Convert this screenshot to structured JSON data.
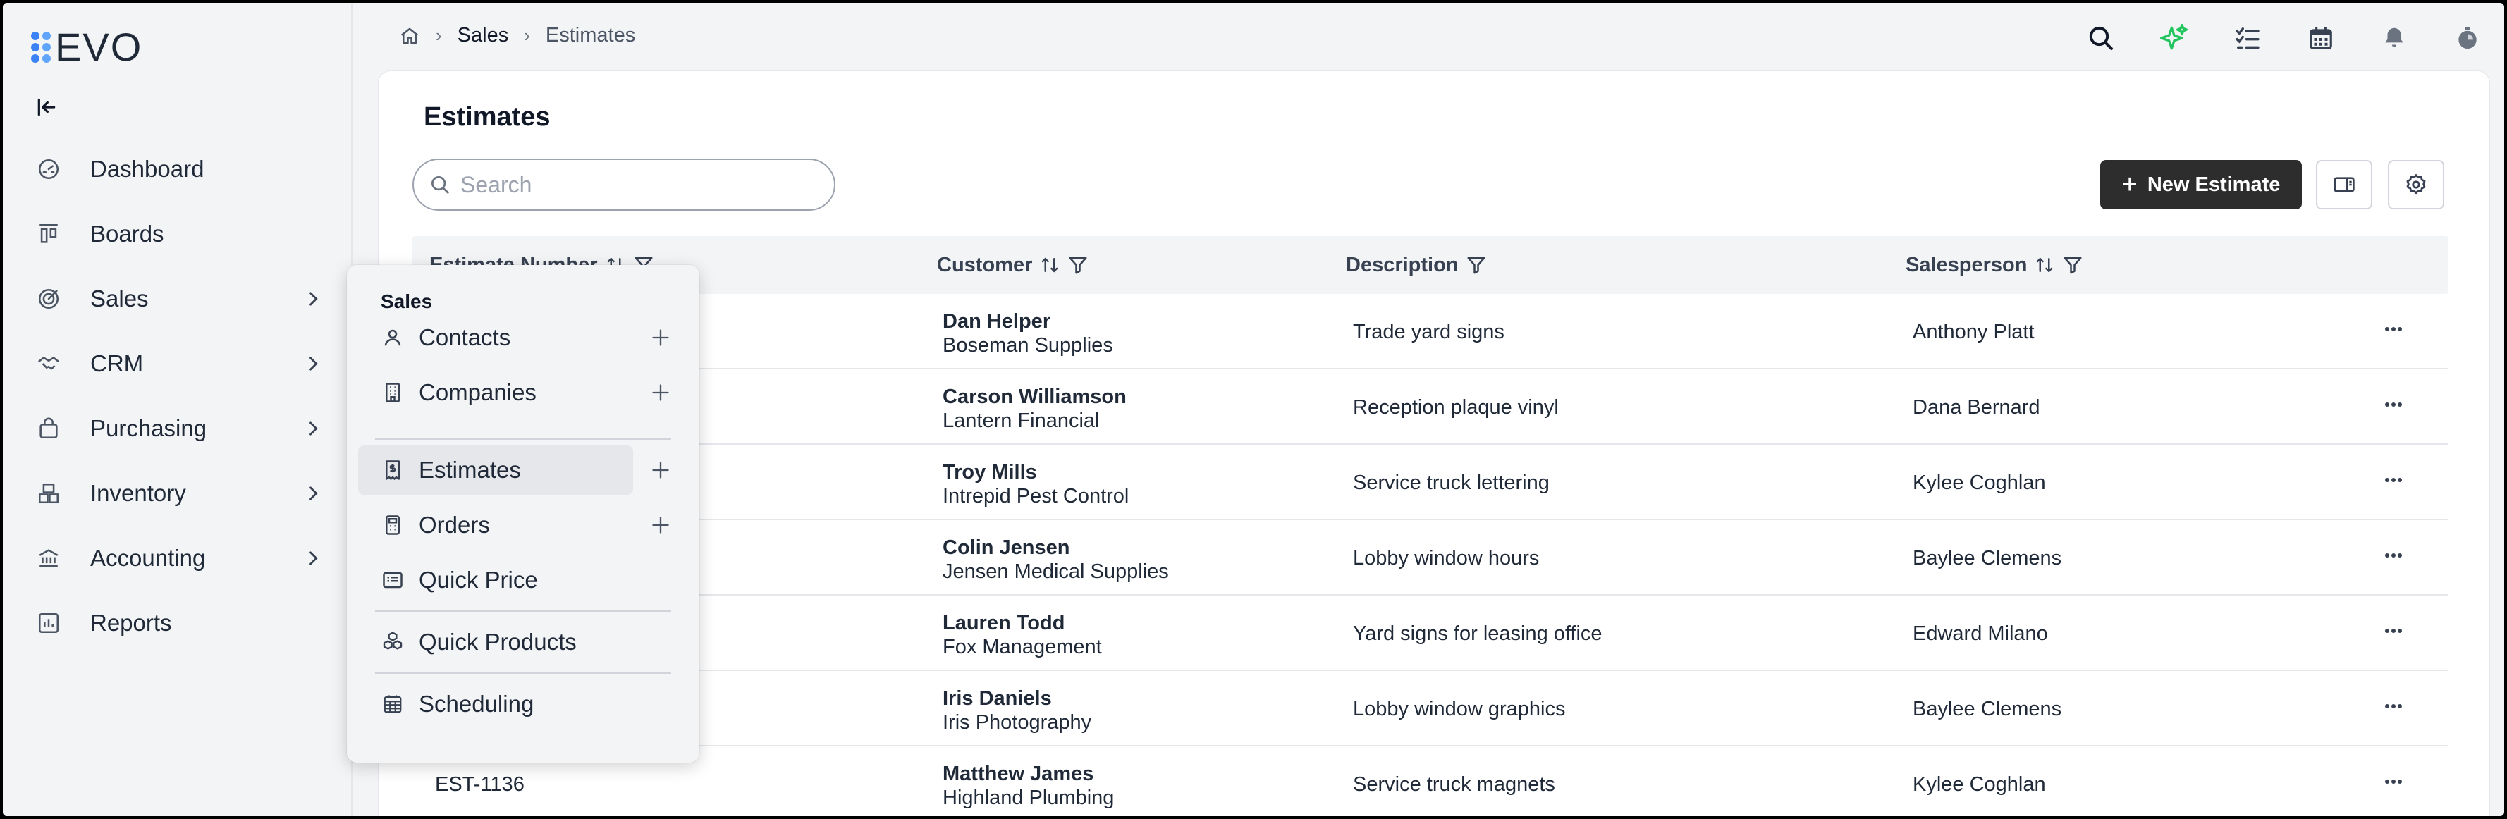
{
  "app": {
    "logo_text": "EVO"
  },
  "breadcrumb": {
    "items": [
      "Sales",
      "Estimates"
    ]
  },
  "sidebar": {
    "items": [
      {
        "label": "Dashboard",
        "icon": "dashboard-icon",
        "has_children": false
      },
      {
        "label": "Boards",
        "icon": "boards-icon",
        "has_children": false
      },
      {
        "label": "Sales",
        "icon": "sales-icon",
        "has_children": true
      },
      {
        "label": "CRM",
        "icon": "handshake-icon",
        "has_children": true
      },
      {
        "label": "Purchasing",
        "icon": "shopping-bag-icon",
        "has_children": true
      },
      {
        "label": "Inventory",
        "icon": "boxes-icon",
        "has_children": true
      },
      {
        "label": "Accounting",
        "icon": "bank-icon",
        "has_children": true
      },
      {
        "label": "Reports",
        "icon": "bar-chart-icon",
        "has_children": false
      }
    ]
  },
  "flyout": {
    "title": "Sales",
    "items": [
      {
        "label": "Contacts",
        "icon": "person-icon",
        "has_add": true
      },
      {
        "label": "Companies",
        "icon": "building-icon",
        "has_add": true
      },
      {
        "label": "Estimates",
        "icon": "estimate-icon",
        "has_add": true,
        "active": true
      },
      {
        "label": "Orders",
        "icon": "calculator-icon",
        "has_add": true
      },
      {
        "label": "Quick Price",
        "icon": "price-list-icon",
        "has_add": false
      },
      {
        "label": "Quick Products",
        "icon": "cubes-icon",
        "has_add": false
      },
      {
        "label": "Scheduling",
        "icon": "calendar-grid-icon",
        "has_add": false
      }
    ]
  },
  "page": {
    "title": "Estimates",
    "search_placeholder": "Search",
    "new_button_label": "New Estimate"
  },
  "table": {
    "columns": [
      "Estimate Number",
      "Customer",
      "Description",
      "Salesperson"
    ],
    "rows": [
      {
        "number": "",
        "contact": "Dan Helper",
        "company": "Boseman Supplies",
        "description": "Trade yard signs",
        "salesperson": "Anthony Platt"
      },
      {
        "number": "",
        "contact": "Carson Williamson",
        "company": "Lantern Financial",
        "description": "Reception plaque vinyl",
        "salesperson": "Dana Bernard"
      },
      {
        "number": "",
        "contact": "Troy Mills",
        "company": "Intrepid Pest Control",
        "description": "Service truck lettering",
        "salesperson": "Kylee Coghlan"
      },
      {
        "number": "",
        "contact": "Colin Jensen",
        "company": "Jensen Medical Supplies",
        "description": "Lobby window hours",
        "salesperson": "Baylee Clemens"
      },
      {
        "number": "",
        "contact": "Lauren Todd",
        "company": "Fox Management",
        "description": "Yard signs for leasing office",
        "salesperson": "Edward Milano"
      },
      {
        "number": "",
        "contact": "Iris Daniels",
        "company": "Iris Photography",
        "description": "Lobby window graphics",
        "salesperson": "Baylee Clemens"
      },
      {
        "number": "EST-1136",
        "contact": "Matthew James",
        "company": "Highland Plumbing",
        "description": "Service truck magnets",
        "salesperson": "Kylee Coghlan"
      }
    ]
  },
  "colors": {
    "accent": "#3b82f6",
    "primary_button": "#2d2d2d",
    "sparkle": "#22c55e"
  }
}
